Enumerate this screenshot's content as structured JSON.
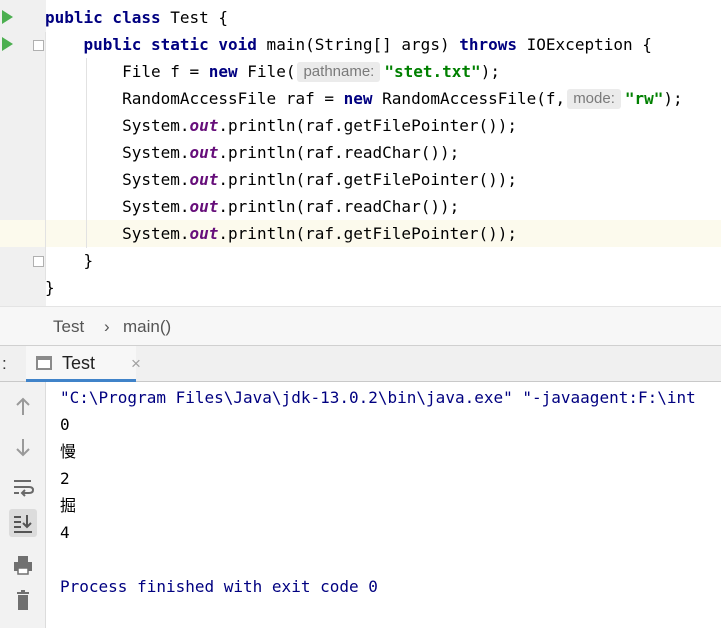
{
  "editor": {
    "lines": [
      {
        "tokens": [
          {
            "t": "kw",
            "v": "public class"
          },
          {
            "t": "pl",
            "v": " Test {"
          }
        ]
      },
      {
        "tokens": [
          {
            "t": "pl",
            "v": "    "
          },
          {
            "t": "kw",
            "v": "public static void"
          },
          {
            "t": "pl",
            "v": " main(String[] args) "
          },
          {
            "t": "kw",
            "v": "throws"
          },
          {
            "t": "pl",
            "v": " IOException {"
          }
        ]
      },
      {
        "tokens": [
          {
            "t": "pl",
            "v": "        File f = "
          },
          {
            "t": "kw",
            "v": "new"
          },
          {
            "t": "pl",
            "v": " File("
          },
          {
            "t": "hint",
            "v": "pathname:"
          },
          {
            "t": "str",
            "v": "\"stet.txt\""
          },
          {
            "t": "pl",
            "v": ");"
          }
        ]
      },
      {
        "tokens": [
          {
            "t": "pl",
            "v": "        RandomAccessFile raf = "
          },
          {
            "t": "kw",
            "v": "new"
          },
          {
            "t": "pl",
            "v": " RandomAccessFile(f,"
          },
          {
            "t": "hint",
            "v": "mode:"
          },
          {
            "t": "str",
            "v": "\"rw\""
          },
          {
            "t": "pl",
            "v": ");"
          }
        ]
      },
      {
        "tokens": [
          {
            "t": "pl",
            "v": "        System."
          },
          {
            "t": "fld",
            "v": "out"
          },
          {
            "t": "pl",
            "v": ".println(raf.getFilePointer());"
          }
        ]
      },
      {
        "tokens": [
          {
            "t": "pl",
            "v": "        System."
          },
          {
            "t": "fld",
            "v": "out"
          },
          {
            "t": "pl",
            "v": ".println(raf.readChar());"
          }
        ]
      },
      {
        "tokens": [
          {
            "t": "pl",
            "v": "        System."
          },
          {
            "t": "fld",
            "v": "out"
          },
          {
            "t": "pl",
            "v": ".println(raf.getFilePointer());"
          }
        ]
      },
      {
        "tokens": [
          {
            "t": "pl",
            "v": "        System."
          },
          {
            "t": "fld",
            "v": "out"
          },
          {
            "t": "pl",
            "v": ".println(raf.readChar());"
          }
        ]
      },
      {
        "tokens": [
          {
            "t": "pl",
            "v": "        System."
          },
          {
            "t": "fld",
            "v": "out"
          },
          {
            "t": "pl",
            "v": ".println(raf.getFilePointer());"
          }
        ]
      },
      {
        "tokens": [
          {
            "t": "pl",
            "v": "    }"
          }
        ]
      },
      {
        "tokens": [
          {
            "t": "pl",
            "v": "}"
          }
        ]
      }
    ],
    "current_line": 9,
    "colors": {
      "keyword": "#000080",
      "string": "#008000",
      "field": "#660e7a",
      "current_line_bg": "#fcfaed",
      "run_gutter": "#4caf50"
    }
  },
  "breadcrumb": {
    "class_name": "Test",
    "separator": "›",
    "method_name": "main()"
  },
  "run_panel": {
    "colon": ":",
    "tab_label": "Test",
    "tab_close": "×",
    "toolbar_icons": [
      "up-arrow-icon",
      "down-arrow-icon",
      "soft-wrap-icon",
      "scroll-to-end-icon",
      "print-icon",
      "trash-icon"
    ],
    "console": {
      "command": "\"C:\\Program Files\\Java\\jdk-13.0.2\\bin\\java.exe\" \"-javaagent:F:\\int",
      "output": [
        "0",
        "慢",
        "2",
        "掘",
        "4"
      ],
      "exit_message": "Process finished with exit code 0"
    }
  }
}
